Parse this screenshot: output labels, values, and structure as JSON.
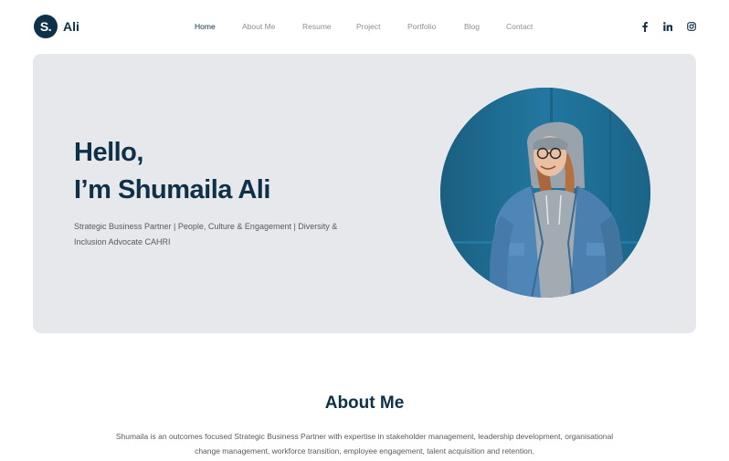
{
  "brand": {
    "mark": "S.",
    "name": "Ali",
    "color": "#0e3048"
  },
  "nav": {
    "items": [
      {
        "label": "Home",
        "active": true
      },
      {
        "label": "About Me",
        "active": false
      },
      {
        "label": "Resume",
        "active": false
      },
      {
        "label": "Project",
        "active": false
      },
      {
        "label": "Portfolio",
        "active": false
      },
      {
        "label": "Blog",
        "active": false
      },
      {
        "label": "Contact",
        "active": false
      }
    ]
  },
  "social": [
    {
      "icon": "facebook-icon"
    },
    {
      "icon": "linkedin-icon"
    },
    {
      "icon": "instagram-icon"
    }
  ],
  "hero": {
    "greeting": "Hello,",
    "name": "I’m Shumaila Ali",
    "tagline": "Strategic Business Partner | People, Culture & Engagement | Diversity & Inclusion Advocate CAHRI",
    "background": "#e6e8eb"
  },
  "about": {
    "title": "About Me",
    "text": "Shumaila is an outcomes focused Strategic Business Partner with expertise in stakeholder management, leadership development, organisational change management, workforce transition, employee engagement, talent acquisition and retention,"
  }
}
